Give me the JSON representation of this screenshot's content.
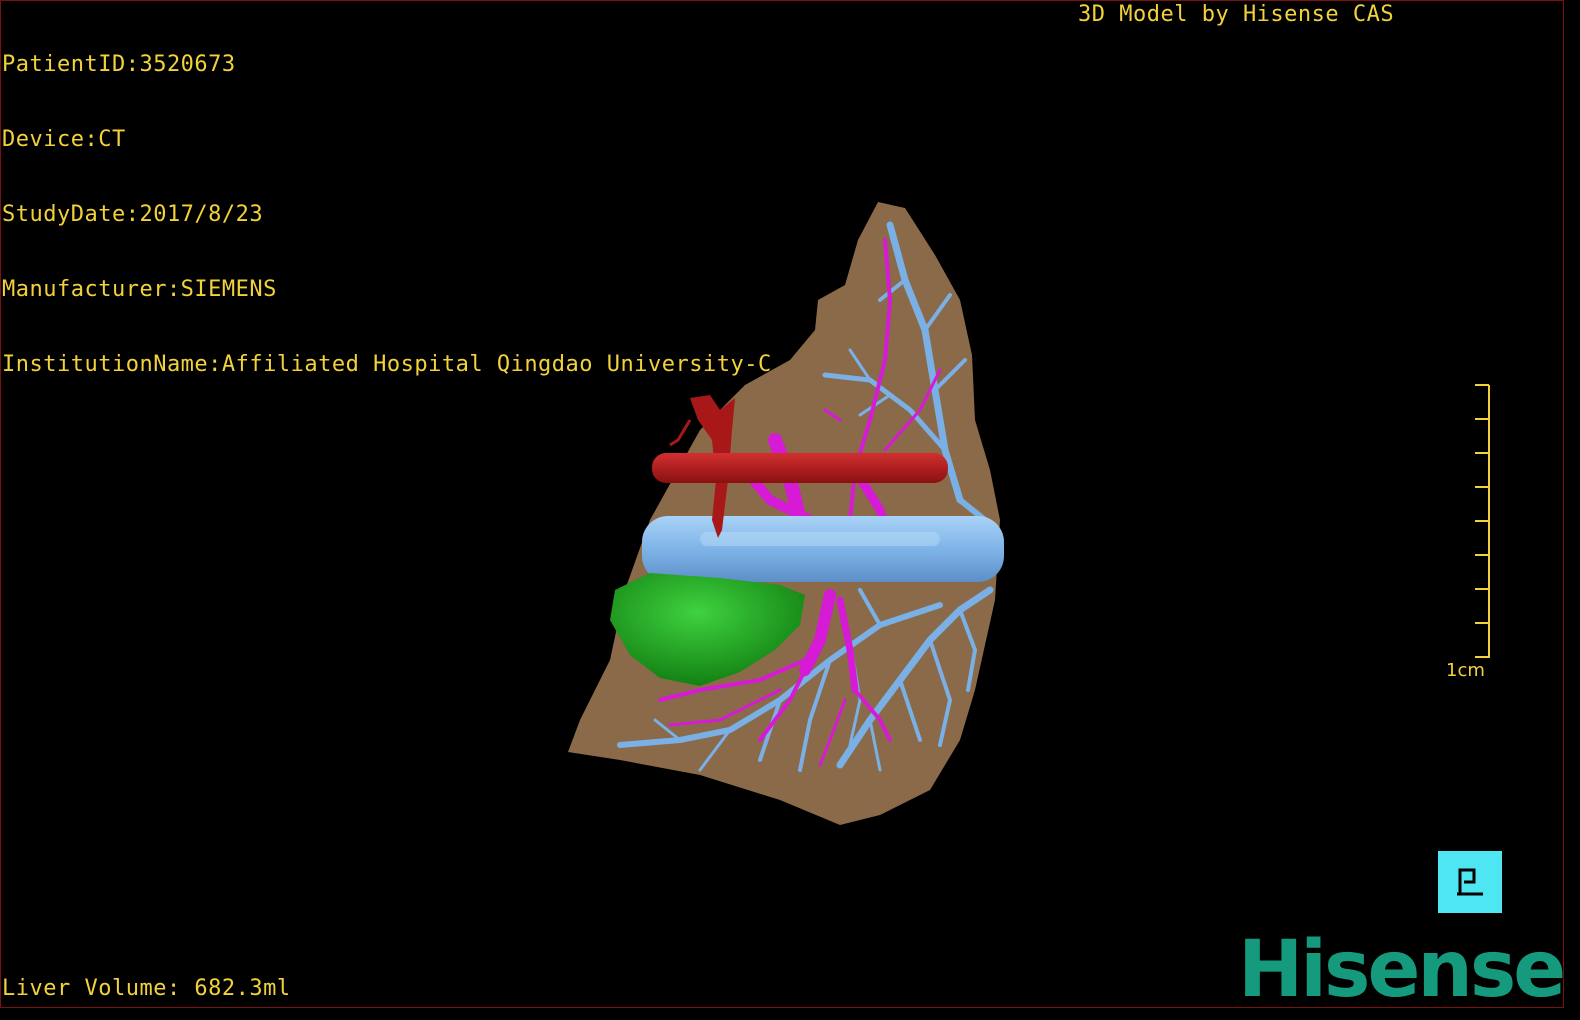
{
  "info": {
    "patient_id": "PatientID:3520673",
    "device": "Device:CT",
    "study_date": "StudyDate:2017/8/23",
    "manufacturer": "Manufacturer:SIEMENS",
    "institution": "InstitutionName:Affiliated Hospital Qingdao University-C"
  },
  "header_right": "3D Model by Hisense CAS",
  "liver_volume": "Liver Volume: 682.3ml",
  "scale": {
    "label": "1cm",
    "color": "#f2d23a"
  },
  "orientation_button": {
    "icon": "posterior-orientation-icon",
    "label": "P"
  },
  "logo_text": "Hisense",
  "colors": {
    "text": "#f2d23a",
    "liver": "#8a6a48",
    "portal_vein": "#7ab0e6",
    "vena_cava": "#8fc0ee",
    "hepatic_artery": "#b51c1c",
    "bile_duct": "#d61ad6",
    "gallbladder": "#1f9a1f",
    "brand": "#169a7e",
    "button": "#4ee6f2"
  }
}
